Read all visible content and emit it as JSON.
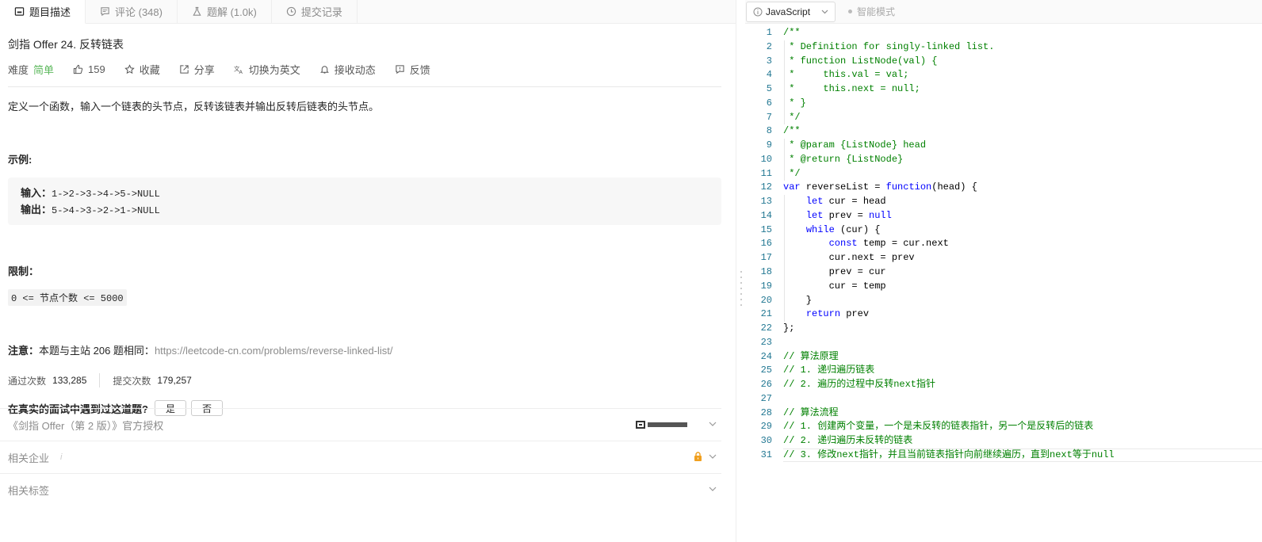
{
  "tabs": [
    {
      "label": "题目描述",
      "icon": "description-icon"
    },
    {
      "label": "评论 (348)",
      "icon": "comment-icon"
    },
    {
      "label": "题解 (1.0k)",
      "icon": "flask-icon"
    },
    {
      "label": "提交记录",
      "icon": "clock-icon"
    }
  ],
  "problem": {
    "title": "剑指 Offer 24. 反转链表",
    "difficulty_label": "难度",
    "difficulty": "简单",
    "likes": "159",
    "favorite": "收藏",
    "share": "分享",
    "translate": "切换为英文",
    "subscribe": "接收动态",
    "feedback": "反馈",
    "description": "定义一个函数，输入一个链表的头节点，反转该链表并输出反转后链表的头节点。",
    "example_heading": "示例:",
    "input_label": "输入：",
    "input_value": "1->2->3->4->5->NULL",
    "output_label": "输出：",
    "output_value": "5->4->3->2->1->NULL",
    "limit_heading": "限制：",
    "limit_value": "0 <= 节点个数 <= 5000",
    "note_label": "注意：",
    "note_text": "本题与主站 206 题相同：",
    "note_link": "https://leetcode-cn.com/problems/reverse-linked-list/",
    "accepted_label": "通过次数",
    "accepted_value": "133,285",
    "submissions_label": "提交次数",
    "submissions_value": "179,257",
    "interview_question": "在真实的面试中遇到过这道题?",
    "yes": "是",
    "no": "否"
  },
  "sections": [
    {
      "label": "《剑指 Offer（第 2 版）》官方授权",
      "extra": "publisher-logo"
    },
    {
      "label": "相关企业",
      "extra": "lock"
    },
    {
      "label": "相关标签",
      "extra": ""
    }
  ],
  "editor": {
    "language": "JavaScript",
    "mode": "智能模式",
    "lines": [
      [
        [
          "cm",
          "/**"
        ]
      ],
      [
        [
          "cm",
          " * Definition for singly-linked list."
        ]
      ],
      [
        [
          "cm",
          " * function ListNode(val) {"
        ]
      ],
      [
        [
          "cm",
          " *     this.val = val;"
        ]
      ],
      [
        [
          "cm",
          " *     this.next = null;"
        ]
      ],
      [
        [
          "cm",
          " * }"
        ]
      ],
      [
        [
          "cm",
          " */"
        ]
      ],
      [
        [
          "cm",
          "/**"
        ]
      ],
      [
        [
          "cm",
          " * @param {ListNode} head"
        ]
      ],
      [
        [
          "cm",
          " * @return {ListNode}"
        ]
      ],
      [
        [
          "cm",
          " */"
        ]
      ],
      [
        [
          "kw",
          "var"
        ],
        [
          "tx",
          " reverseList = "
        ],
        [
          "kw",
          "function"
        ],
        [
          "tx",
          "(head) {"
        ]
      ],
      [
        [
          "tx",
          "    "
        ],
        [
          "kw",
          "let"
        ],
        [
          "tx",
          " cur = head"
        ]
      ],
      [
        [
          "tx",
          "    "
        ],
        [
          "kw",
          "let"
        ],
        [
          "tx",
          " prev = "
        ],
        [
          "kw",
          "null"
        ]
      ],
      [
        [
          "tx",
          "    "
        ],
        [
          "kw",
          "while"
        ],
        [
          "tx",
          " (cur) {"
        ]
      ],
      [
        [
          "tx",
          "        "
        ],
        [
          "kw",
          "const"
        ],
        [
          "tx",
          " temp = cur.next"
        ]
      ],
      [
        [
          "tx",
          "        cur.next = prev"
        ]
      ],
      [
        [
          "tx",
          "        prev = cur"
        ]
      ],
      [
        [
          "tx",
          "        cur = temp"
        ]
      ],
      [
        [
          "tx",
          "    }"
        ]
      ],
      [
        [
          "tx",
          "    "
        ],
        [
          "kw",
          "return"
        ],
        [
          "tx",
          " prev"
        ]
      ],
      [
        [
          "tx",
          "};"
        ]
      ],
      [],
      [
        [
          "cm",
          "// 算法原理"
        ]
      ],
      [
        [
          "cm",
          "// 1. 递归遍历链表"
        ]
      ],
      [
        [
          "cm",
          "// 2. 遍历的过程中反转next指针"
        ]
      ],
      [],
      [
        [
          "cm",
          "// 算法流程"
        ]
      ],
      [
        [
          "cm",
          "// 1. 创建两个变量，一个是未反转的链表指针，另一个是反转后的链表"
        ]
      ],
      [
        [
          "cm",
          "// 2. 递归遍历未反转的链表"
        ]
      ],
      [
        [
          "cm",
          "// 3. 修改next指针，并且当前链表指针向前继续遍历，直到next等于null"
        ]
      ]
    ]
  },
  "colors": {
    "accent_easy": "#5cb85c",
    "keyword": "#0000ff",
    "comment": "#008000",
    "line_number": "#237893",
    "lock": "#f0a020"
  }
}
